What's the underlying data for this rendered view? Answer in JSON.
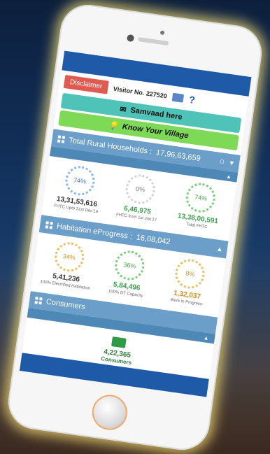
{
  "header": {
    "disclaimer_label": "Disclaimer",
    "visitor_label": "Visitor No.",
    "visitor_number": "227520",
    "help_label": "?"
  },
  "buttons": {
    "samvaad": "Samvaad here",
    "village": "Know Your Village"
  },
  "sections": {
    "households": {
      "title": "Total Rural Households :",
      "total": "17,96,63,659",
      "stats": [
        {
          "pct": "74%",
          "value": "13,31,53,616",
          "label": "FHTC Upto 31st Dec'19",
          "level": 0.74
        },
        {
          "pct": "0%",
          "value": "6,46,975",
          "label": "FHTC from 1st Jan'17",
          "level": 0.0
        },
        {
          "pct": "74%",
          "value": "13,38,00,591",
          "label": "Total FHTC",
          "level": 0.74
        }
      ]
    },
    "habitation": {
      "title": "Habitation eProgress :",
      "total": "16,08,042",
      "stats": [
        {
          "pct": "34%",
          "value": "5,41,236",
          "label": "100% Electrified Habitation",
          "level": 0.34
        },
        {
          "pct": "36%",
          "value": "5,84,496",
          "label": "100% DT Capacity",
          "level": 0.36
        },
        {
          "pct": "8%",
          "value": "1,32,037",
          "label": "Work in Progress",
          "level": 0.08
        }
      ]
    },
    "consumers": {
      "title": "Consumers",
      "value": "4,22,365",
      "label": "Consumers"
    }
  },
  "colors": {
    "top_bar": "#1f5aa8",
    "disclaimer": "#e05a4f",
    "samvaad": "#4fc3b7",
    "village": "#7ed957",
    "panel": "#6b9ec8"
  }
}
